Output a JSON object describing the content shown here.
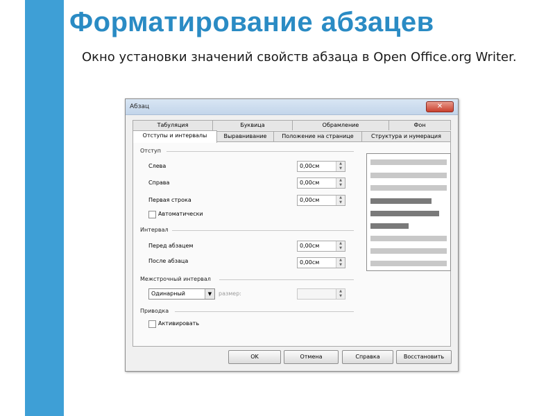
{
  "slide": {
    "title": "Форматирование абзацев",
    "subtitle": "Окно установки значений свойств абзаца в Open Office.org Writer."
  },
  "dialog": {
    "title": "Абзац",
    "close_label": "✕",
    "tabs_back": [
      "Табуляция",
      "Буквица",
      "Обрамление",
      "Фон"
    ],
    "tabs_front": [
      "Отступы и интервалы",
      "Выравнивание",
      "Положение на странице",
      "Структура и нумерация"
    ],
    "active_tab": "Отступы и интервалы",
    "indent": {
      "group": "Отступ",
      "left_label": "Слева",
      "left_value": "0,00см",
      "right_label": "Справа",
      "right_value": "0,00см",
      "first_line_label": "Первая строка",
      "first_line_value": "0,00см",
      "auto_label": "Автоматически"
    },
    "spacing": {
      "group": "Интервал",
      "before_label": "Перед абзацем",
      "before_value": "0,00см",
      "after_label": "После абзаца",
      "after_value": "0,00см"
    },
    "line_spacing": {
      "group": "Межстрочный интервал",
      "selected": "Одинарный",
      "size_label": "размер:",
      "size_value": ""
    },
    "register": {
      "group": "Приводка",
      "activate_label": "Активировать"
    },
    "buttons": {
      "ok": "OK",
      "cancel": "Отмена",
      "help": "Справка",
      "reset": "Восстановить"
    }
  },
  "colors": {
    "accent_bar": "#3e9fd6",
    "title": "#2a8bc4",
    "preview_light": "#c8c8c8",
    "preview_dark": "#7a7a7a"
  }
}
